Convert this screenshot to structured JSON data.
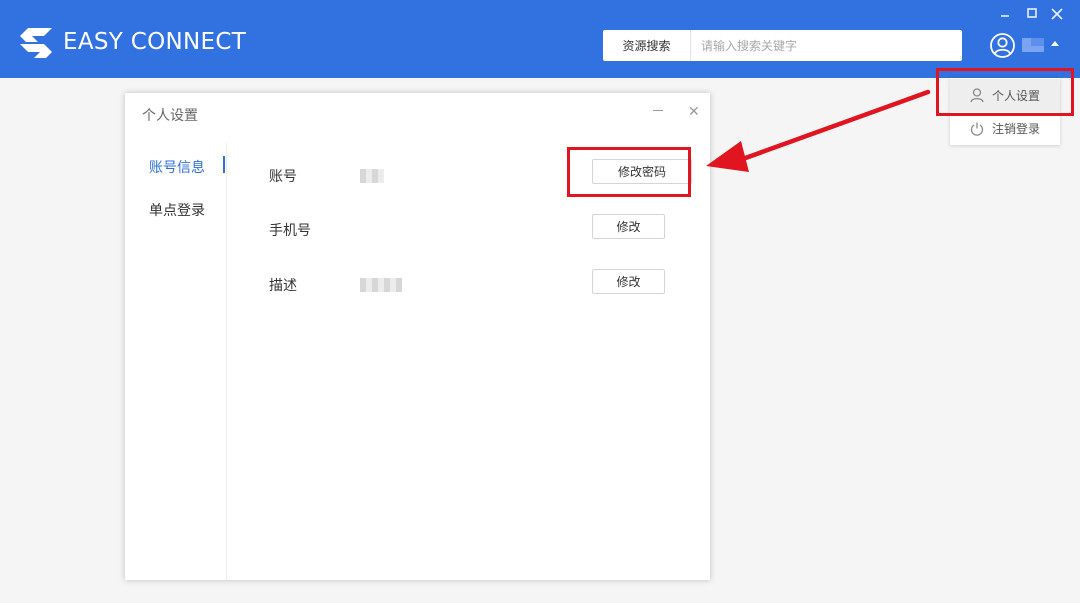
{
  "app": {
    "brand": "EASY CONNECT",
    "accent_color": "#3171e0"
  },
  "search": {
    "scope_label": "资源搜索",
    "placeholder": "请输入搜索关键字",
    "value": ""
  },
  "user_menu": {
    "items": [
      {
        "label": "个人设置",
        "icon": "user-icon",
        "active": true
      },
      {
        "label": "注销登录",
        "icon": "power-icon",
        "active": false
      }
    ]
  },
  "dialog": {
    "title": "个人设置",
    "sidebar": [
      {
        "label": "账号信息",
        "active": true
      },
      {
        "label": "单点登录",
        "active": false
      }
    ],
    "rows": [
      {
        "label": "账号",
        "button": "修改密码"
      },
      {
        "label": "手机号",
        "button": "修改"
      },
      {
        "label": "描述",
        "button": "修改"
      }
    ]
  },
  "annotation_color": "#e0151f"
}
